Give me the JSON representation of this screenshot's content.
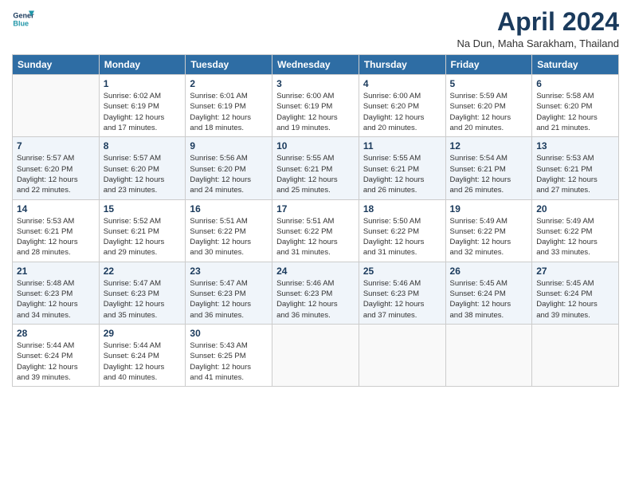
{
  "header": {
    "logo_line1": "General",
    "logo_line2": "Blue",
    "title": "April 2024",
    "location": "Na Dun, Maha Sarakham, Thailand"
  },
  "days_of_week": [
    "Sunday",
    "Monday",
    "Tuesday",
    "Wednesday",
    "Thursday",
    "Friday",
    "Saturday"
  ],
  "weeks": [
    [
      {
        "day": "",
        "info": ""
      },
      {
        "day": "1",
        "info": "Sunrise: 6:02 AM\nSunset: 6:19 PM\nDaylight: 12 hours\nand 17 minutes."
      },
      {
        "day": "2",
        "info": "Sunrise: 6:01 AM\nSunset: 6:19 PM\nDaylight: 12 hours\nand 18 minutes."
      },
      {
        "day": "3",
        "info": "Sunrise: 6:00 AM\nSunset: 6:19 PM\nDaylight: 12 hours\nand 19 minutes."
      },
      {
        "day": "4",
        "info": "Sunrise: 6:00 AM\nSunset: 6:20 PM\nDaylight: 12 hours\nand 20 minutes."
      },
      {
        "day": "5",
        "info": "Sunrise: 5:59 AM\nSunset: 6:20 PM\nDaylight: 12 hours\nand 20 minutes."
      },
      {
        "day": "6",
        "info": "Sunrise: 5:58 AM\nSunset: 6:20 PM\nDaylight: 12 hours\nand 21 minutes."
      }
    ],
    [
      {
        "day": "7",
        "info": "Sunrise: 5:57 AM\nSunset: 6:20 PM\nDaylight: 12 hours\nand 22 minutes."
      },
      {
        "day": "8",
        "info": "Sunrise: 5:57 AM\nSunset: 6:20 PM\nDaylight: 12 hours\nand 23 minutes."
      },
      {
        "day": "9",
        "info": "Sunrise: 5:56 AM\nSunset: 6:20 PM\nDaylight: 12 hours\nand 24 minutes."
      },
      {
        "day": "10",
        "info": "Sunrise: 5:55 AM\nSunset: 6:21 PM\nDaylight: 12 hours\nand 25 minutes."
      },
      {
        "day": "11",
        "info": "Sunrise: 5:55 AM\nSunset: 6:21 PM\nDaylight: 12 hours\nand 26 minutes."
      },
      {
        "day": "12",
        "info": "Sunrise: 5:54 AM\nSunset: 6:21 PM\nDaylight: 12 hours\nand 26 minutes."
      },
      {
        "day": "13",
        "info": "Sunrise: 5:53 AM\nSunset: 6:21 PM\nDaylight: 12 hours\nand 27 minutes."
      }
    ],
    [
      {
        "day": "14",
        "info": "Sunrise: 5:53 AM\nSunset: 6:21 PM\nDaylight: 12 hours\nand 28 minutes."
      },
      {
        "day": "15",
        "info": "Sunrise: 5:52 AM\nSunset: 6:21 PM\nDaylight: 12 hours\nand 29 minutes."
      },
      {
        "day": "16",
        "info": "Sunrise: 5:51 AM\nSunset: 6:22 PM\nDaylight: 12 hours\nand 30 minutes."
      },
      {
        "day": "17",
        "info": "Sunrise: 5:51 AM\nSunset: 6:22 PM\nDaylight: 12 hours\nand 31 minutes."
      },
      {
        "day": "18",
        "info": "Sunrise: 5:50 AM\nSunset: 6:22 PM\nDaylight: 12 hours\nand 31 minutes."
      },
      {
        "day": "19",
        "info": "Sunrise: 5:49 AM\nSunset: 6:22 PM\nDaylight: 12 hours\nand 32 minutes."
      },
      {
        "day": "20",
        "info": "Sunrise: 5:49 AM\nSunset: 6:22 PM\nDaylight: 12 hours\nand 33 minutes."
      }
    ],
    [
      {
        "day": "21",
        "info": "Sunrise: 5:48 AM\nSunset: 6:23 PM\nDaylight: 12 hours\nand 34 minutes."
      },
      {
        "day": "22",
        "info": "Sunrise: 5:47 AM\nSunset: 6:23 PM\nDaylight: 12 hours\nand 35 minutes."
      },
      {
        "day": "23",
        "info": "Sunrise: 5:47 AM\nSunset: 6:23 PM\nDaylight: 12 hours\nand 36 minutes."
      },
      {
        "day": "24",
        "info": "Sunrise: 5:46 AM\nSunset: 6:23 PM\nDaylight: 12 hours\nand 36 minutes."
      },
      {
        "day": "25",
        "info": "Sunrise: 5:46 AM\nSunset: 6:23 PM\nDaylight: 12 hours\nand 37 minutes."
      },
      {
        "day": "26",
        "info": "Sunrise: 5:45 AM\nSunset: 6:24 PM\nDaylight: 12 hours\nand 38 minutes."
      },
      {
        "day": "27",
        "info": "Sunrise: 5:45 AM\nSunset: 6:24 PM\nDaylight: 12 hours\nand 39 minutes."
      }
    ],
    [
      {
        "day": "28",
        "info": "Sunrise: 5:44 AM\nSunset: 6:24 PM\nDaylight: 12 hours\nand 39 minutes."
      },
      {
        "day": "29",
        "info": "Sunrise: 5:44 AM\nSunset: 6:24 PM\nDaylight: 12 hours\nand 40 minutes."
      },
      {
        "day": "30",
        "info": "Sunrise: 5:43 AM\nSunset: 6:25 PM\nDaylight: 12 hours\nand 41 minutes."
      },
      {
        "day": "",
        "info": ""
      },
      {
        "day": "",
        "info": ""
      },
      {
        "day": "",
        "info": ""
      },
      {
        "day": "",
        "info": ""
      }
    ]
  ]
}
